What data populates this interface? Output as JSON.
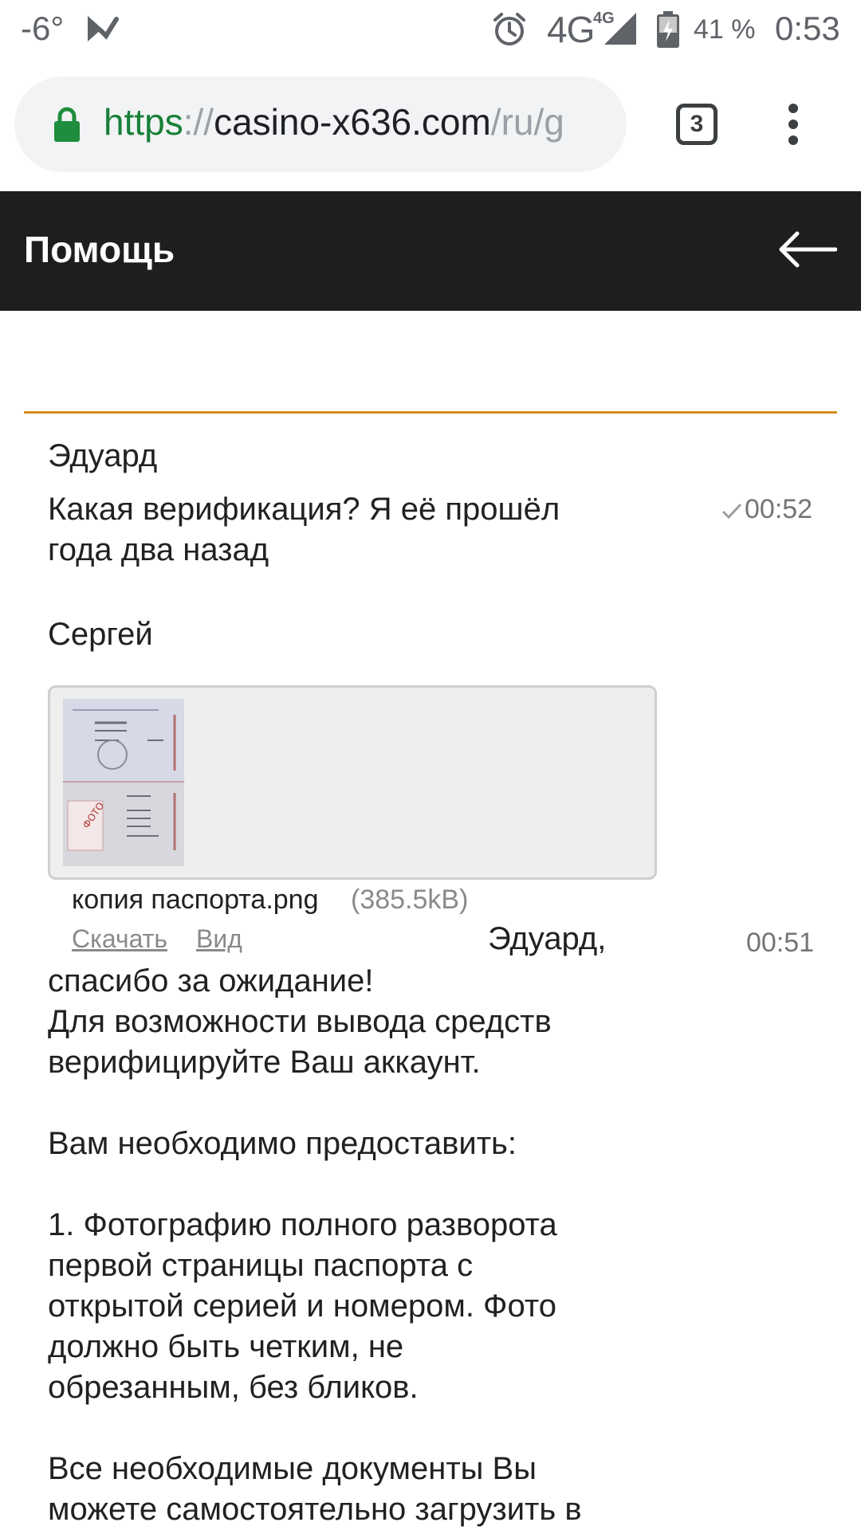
{
  "status_bar": {
    "temperature": "-6°",
    "network": "4G",
    "network_sup": "4G",
    "battery": "41 %",
    "time": "0:53",
    "icons": [
      "notification-check-icon",
      "alarm-icon",
      "signal-icon",
      "battery-charging-icon"
    ]
  },
  "browser": {
    "url_scheme": "https",
    "url_sep": "://",
    "url_host": "casino-x636.com",
    "url_path": "/ru/g",
    "tabs_count": "3",
    "icons": [
      "lock-icon",
      "tabs-icon",
      "more-vert-icon"
    ],
    "lock_color": "#1e8e3e"
  },
  "header": {
    "title": "Помощь",
    "icons": [
      "back-arrow-icon"
    ],
    "background": "#1e1e1e"
  },
  "chat": {
    "accent_color": "#d88f1e",
    "messages": [
      {
        "sender": "Эдуард",
        "text": "Какая верификация? Я её прошёл\nгода два назад",
        "time": "00:52",
        "status_icon": "check-icon"
      },
      {
        "sender": "Сергей",
        "attachment": {
          "file_name": "копия паспорта.png",
          "file_size": "(385.5kB)",
          "download_label": "Скачать",
          "view_label": "Вид",
          "thumbnail_icon": "passport-image"
        },
        "greeting": "Эдуард,",
        "text": "спасибо за ожидание!\nДля возможности вывода средств\nверифицируйте Ваш аккаунт.\n\nВам необходимо предоставить:\n\n1. Фотографию полного разворота\nпервой страницы паспорта с\nоткрытой серией и номером. Фото\nдолжно быть четким, не\nобрезанным, без бликов.\n\nВсе необходимые документы Вы\nможете самостоятельно загрузить в",
        "time": "00:51"
      }
    ]
  }
}
